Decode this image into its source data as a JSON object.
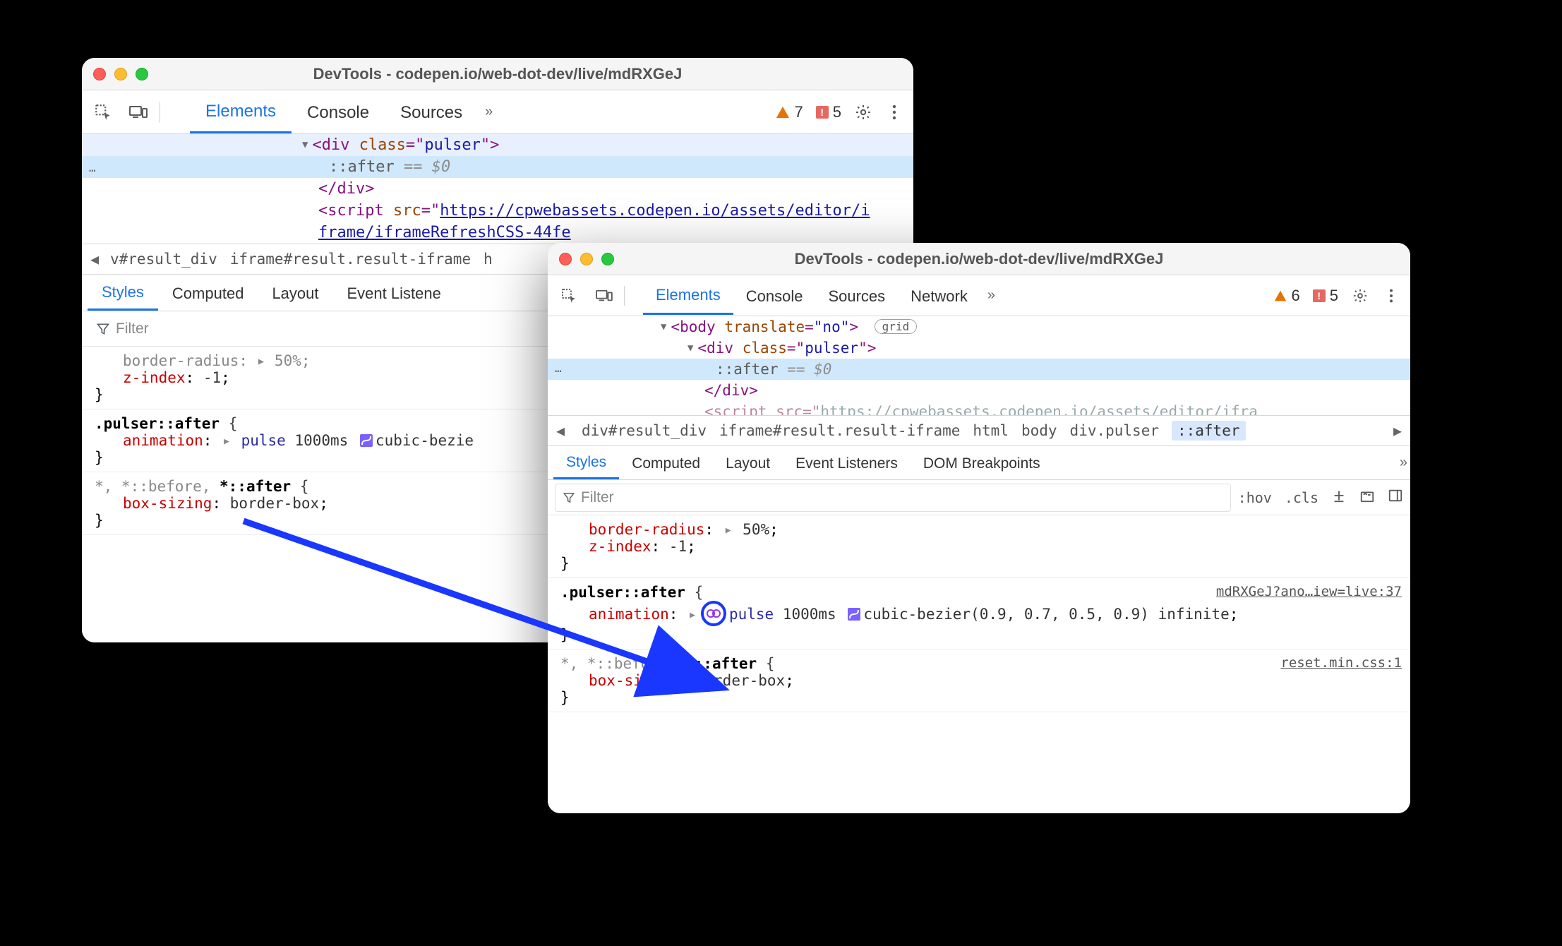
{
  "windowA": {
    "title": "DevTools - codepen.io/web-dot-dev/live/mdRXGeJ",
    "tabs": {
      "elements": "Elements",
      "console": "Console",
      "sources": "Sources"
    },
    "overflow": "»",
    "warnings": "7",
    "errors": "5",
    "dom": {
      "div_open": "<div class=\"pulser\">",
      "pseudo": "::after",
      "eq": "== $0",
      "div_close": "</div>",
      "script_prefix": "<script src=\"",
      "script_url1": "https://cpwebassets.codepen.io/assets/editor/i",
      "script_url2": "frame/iframeRefreshCSS-44fe",
      "gutter": "…"
    },
    "breadcrumb": {
      "left_trunc": "v#result_div",
      "iframe": "iframe#result.result-iframe",
      "right_trunc": "h"
    },
    "subtabs": {
      "styles": "Styles",
      "computed": "Computed",
      "layout": "Layout",
      "listeners": "Event Listene"
    },
    "filter": "Filter",
    "styles": {
      "block1_crop": "border-radius: ▸ 50%;",
      "block1_zindex_name": "z-index",
      "block1_zindex_val": "-1",
      "block2_sel": ".pulser::after {",
      "block2_anim_name": "animation",
      "block2_anim_val_name": "pulse",
      "block2_anim_val_dur": "1000ms",
      "block2_anim_val_timing": "cubic-bezie",
      "block3_sel": "*, *::before, *::after {",
      "block3_bs_name": "box-sizing",
      "block3_bs_val": "border-box"
    }
  },
  "windowB": {
    "title": "DevTools - codepen.io/web-dot-dev/live/mdRXGeJ",
    "tabs": {
      "elements": "Elements",
      "console": "Console",
      "sources": "Sources",
      "network": "Network"
    },
    "overflow": "»",
    "warnings": "6",
    "errors": "5",
    "dom": {
      "body_open_a": "<body ",
      "body_attr_name": "translate",
      "body_attr_val": "\"no\"",
      "body_open_b": ">",
      "grid_badge": "grid",
      "div_open": "<div class=\"pulser\">",
      "pseudo": "::after",
      "eq": "== $0",
      "div_close": "</div>",
      "script_crop": "<script src=\"https://cpwebassets.codepen.io/assets/editor/ifra",
      "gutter": "…"
    },
    "breadcrumb": {
      "c1": "div#result_div",
      "c2": "iframe#result.result-iframe",
      "c3": "html",
      "c4": "body",
      "c5": "div.pulser",
      "c6": "::after"
    },
    "subtabs": {
      "styles": "Styles",
      "computed": "Computed",
      "layout": "Layout",
      "listeners": "Event Listeners",
      "dombp": "DOM Breakpoints"
    },
    "filter": "Filter",
    "filter_right": {
      "hov": ":hov",
      "cls": ".cls"
    },
    "styles": {
      "block1_br_name": "border-radius",
      "block1_br_val": "50%",
      "block1_zi_name": "z-index",
      "block1_zi_val": "-1",
      "block2_sel": ".pulser::after {",
      "block2_src": "mdRXGeJ?ano…iew=live:37",
      "block2_anim_name": "animation",
      "block2_anim_valname": "pulse",
      "block2_anim_dur": "1000ms",
      "block2_anim_timing": "cubic-bezier(0.9, 0.7, 0.5, 0.9)",
      "block2_anim_inf": "infinite",
      "block3_sel": "*, *::before, *::after {",
      "block3_src": "reset.min.css:1",
      "block3_bs_name": "box-sizing",
      "block3_bs_val": "border-box"
    }
  }
}
